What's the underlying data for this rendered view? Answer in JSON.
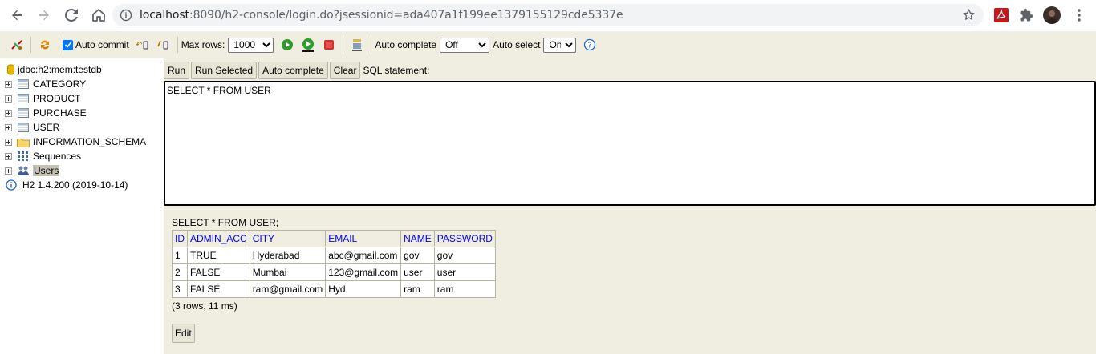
{
  "browser": {
    "url_host": "localhost",
    "url_rest": ":8090/h2-console/login.do?jsessionid=ada407a1f199ee1379155129cde5337e",
    "icons": [
      "back-icon",
      "forward-icon",
      "reload-icon",
      "home-icon",
      "site-info-icon",
      "bookmark-star-icon",
      "pdf-extension-icon",
      "extensions-puzzle-icon",
      "profile-avatar",
      "browser-menu-icon"
    ]
  },
  "toolbar": {
    "auto_commit": "Auto commit",
    "max_rows_label": "Max rows:",
    "max_rows_value": "1000",
    "auto_complete_label": "Auto complete",
    "auto_complete_value": "Off",
    "auto_select_label": "Auto select",
    "auto_select_value": "On",
    "help": "?"
  },
  "tree": {
    "connection": "jdbc:h2:mem:testdb",
    "items": [
      {
        "label": "CATEGORY",
        "icon": "table-icon"
      },
      {
        "label": "PRODUCT",
        "icon": "table-icon"
      },
      {
        "label": "PURCHASE",
        "icon": "table-icon"
      },
      {
        "label": "USER",
        "icon": "table-icon"
      },
      {
        "label": "INFORMATION_SCHEMA",
        "icon": "folder-icon"
      },
      {
        "label": "Sequences",
        "icon": "sequences-icon"
      },
      {
        "label": "Users",
        "icon": "users-icon"
      }
    ],
    "version": "H2 1.4.200 (2019-10-14)"
  },
  "editor": {
    "run": "Run",
    "run_selected": "Run Selected",
    "auto_complete": "Auto complete",
    "clear": "Clear",
    "sql_label": "SQL statement:",
    "sql": "SELECT * FROM USER"
  },
  "result": {
    "statement": "SELECT * FROM USER;",
    "columns": [
      "ID",
      "ADMIN_ACC",
      "CITY",
      "EMAIL",
      "NAME",
      "PASSWORD"
    ],
    "rows": [
      [
        "1",
        "TRUE",
        "Hyderabad",
        "abc@gmail.com",
        "gov",
        "gov"
      ],
      [
        "2",
        "FALSE",
        "Mumbai",
        "123@gmail.com",
        "user",
        "user"
      ],
      [
        "3",
        "FALSE",
        "ram@gmail.com",
        "Hyd",
        "ram",
        "ram"
      ]
    ],
    "summary": "(3 rows, 11 ms)",
    "edit": "Edit"
  },
  "colors": {
    "panel_bg": "#efeee0",
    "header_text": "#0000ff",
    "checkbox": "#0075ff"
  }
}
